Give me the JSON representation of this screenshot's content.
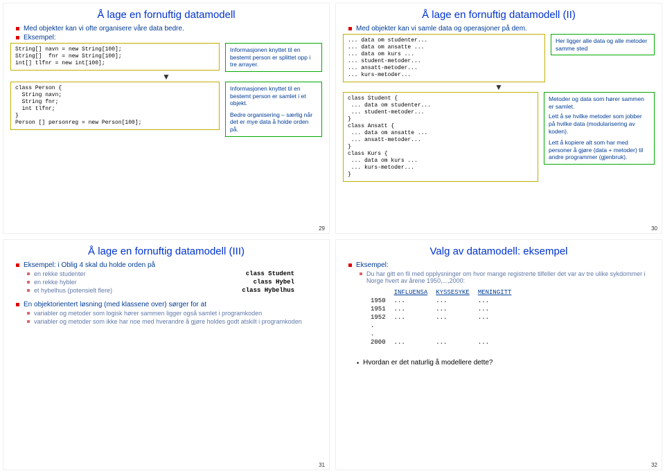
{
  "s29": {
    "title": "Å lage en fornuftig datamodell",
    "intro": "Med objekter kan vi ofte organisere våre data bedre.",
    "eks": "Eksempel:",
    "code1": "String[] navn = new String[100];\nString[]  fnr = new String[100];\nint[] tlfnr = new int[100];",
    "box1": "Informasjonen knyttet til en bestemt person er splittet opp i tre arrayer.",
    "code2": "class Person {\n  String navn;\n  String fnr;\n  int tlfnr;\n}\nPerson [] personreg = new Person[100];",
    "box2a": "Informasjonen knyttet til en bestemt person er samlet i et objekt.",
    "box2b": "Bedre organisering – særlig når det er mye data å holde\norden på.",
    "page": "29"
  },
  "s30": {
    "title": "Å lage en fornuftig datamodell (II)",
    "intro": "Med objekter kan vi samle data og operasjoner på dem.",
    "list1": "... data om studenter...\n... data om ansatte ...\n... data om kurs ...\n... student-metoder...\n... ansatt-metoder...\n... kurs-metoder...",
    "box1": "Her ligger alle data og alle metoder samme sted",
    "code2": "class Student {\n ... data om studenter...\n ... student-metoder...\n}\nclass Ansatt {\n ... data om ansatte ...\n ... ansatt-metoder...\n}\nclass Kurs {\n ... data om kurs ...\n ... kurs-metoder...\n}",
    "box2a": "Metoder og data som hører sammen er samlet.",
    "box2b": "Lett å se hvilke metoder som jobber på hvilke data (modularisering av koden).",
    "box2c": "Lett å kopiere alt som har med personer å gjøre (data + metoder) til andre programmer (gjenbruk).",
    "page": "30"
  },
  "s31": {
    "title": "Å lage en fornuftig datamodell (III)",
    "l1": "Eksempel: i Oblig 4 skal du holde orden på",
    "rows": [
      {
        "t": "en rekke studenter",
        "c": "class Student"
      },
      {
        "t": "en rekke hybler",
        "c": "class Hybel"
      },
      {
        "t": "et hybelhus (potensielt flere)",
        "c": "class Hybelhus"
      }
    ],
    "l2": "En objektorientert løsning (med klassene over) sørger for at",
    "sub1": "variabler og metoder som logisk hører sammen ligger også samlet i programkoden",
    "sub2": "variabler og metoder som ikke har noe med hverandre å gjøre holdes godt atskilt i programkoden",
    "page": "31"
  },
  "s32": {
    "title": "Valg av datamodell: eksempel",
    "e": "Eksempel:",
    "l1": "Du har gitt en fil med opplysninger om hvor mange registrerte tilfeller det var av tre ulike sykdommer i Norge hvert av årene 1950,...,2000:",
    "th": [
      "",
      "INFLUENSA",
      "KYSSESYKE",
      "MENINGITT"
    ],
    "tr": [
      [
        "1950",
        "...",
        "...",
        "..."
      ],
      [
        "1951",
        "...",
        "...",
        "..."
      ],
      [
        "1952",
        "...",
        "...",
        "..."
      ],
      [
        ".",
        "",
        "",
        ""
      ],
      [
        ".",
        "",
        "",
        ""
      ],
      [
        "2000",
        "...",
        "...",
        "..."
      ]
    ],
    "q": "Hvordan er det naturlig å modellere dette?",
    "page": "32"
  }
}
